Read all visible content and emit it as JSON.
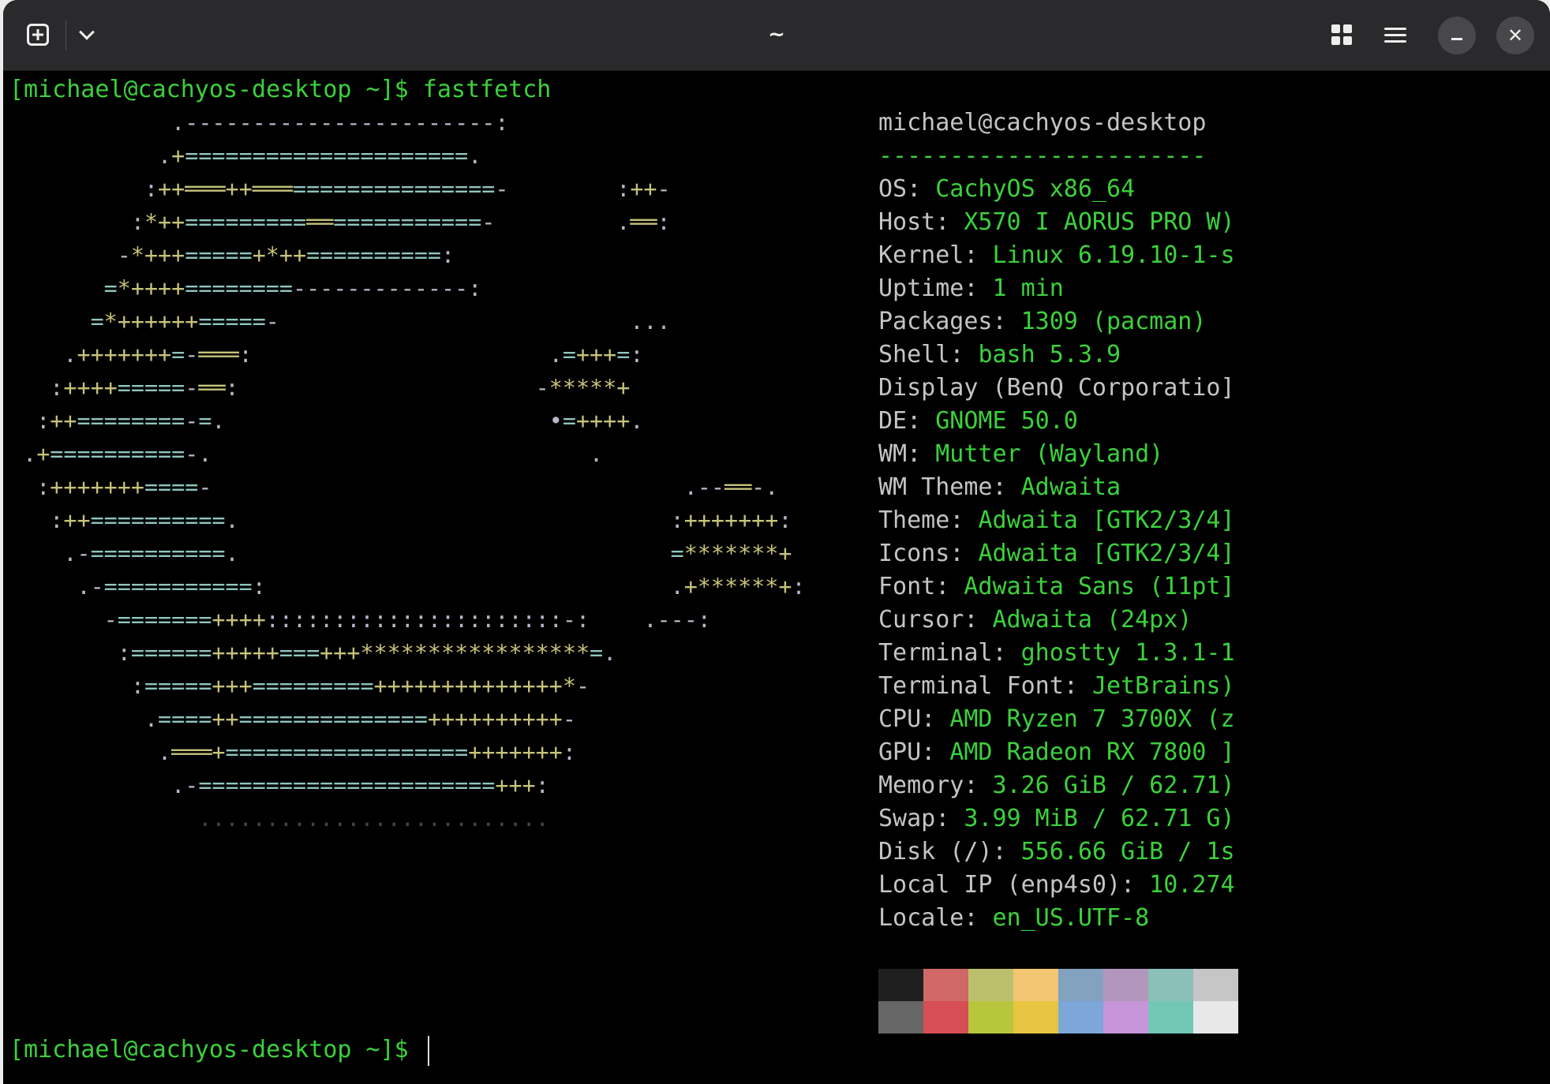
{
  "titlebar": {
    "title": "~"
  },
  "terminal": {
    "prompt1": "[michael@cachyos-desktop ~]$ ",
    "command1": "fastfetch",
    "prompt2": "[michael@cachyos-desktop ~]$ "
  },
  "logo_rows": [
    "            .-----------------------:",
    "           .+=====================.",
    "          :++═══++═══===============-        :++-",
    "         :*++=========══===========-         .══:",
    "        -*+++=====+*++==========:",
    "       =*++++========-------------:",
    "      =*++++++=====-                          ...",
    "    .+++++++=-═══:                      .=+++=:",
    "   :++++=====-══:                      -*****+",
    "  :++========-=.                        •=++++.",
    " .+==========-.                            .",
    "  :+++++++====-                                   .--══-.",
    "   :++==========.                                :+++++++:",
    "    .-==========.                                =*******+",
    "     .-===========:                              .+******+:",
    "       -=======++++::::::::::::::::::::::-:    .---:",
    "        :======+++++===+++*****************=.",
    "         :=====+++=========++++++++++++++*-",
    "          .====++==============++++++++++-",
    "           .═══+==================+++++++:",
    "            .-======================+++:",
    "              .........................."
  ],
  "info": {
    "header": "michael@cachyos-desktop",
    "separator": "-----------------------",
    "items": [
      {
        "key": "OS",
        "value": "CachyOS x86_64"
      },
      {
        "key": "Host",
        "value": "X570 I AORUS PRO W)"
      },
      {
        "key": "Kernel",
        "value": "Linux 6.19.10-1-s"
      },
      {
        "key": "Uptime",
        "value": "1 min"
      },
      {
        "key": "Packages",
        "value": "1309 (pacman)"
      },
      {
        "key": "Shell",
        "value": "bash 5.3.9"
      },
      {
        "key": "Display (BenQ Corporatio]",
        "value": "",
        "nocolon": true
      },
      {
        "key": "DE",
        "value": "GNOME 50.0"
      },
      {
        "key": "WM",
        "value": "Mutter (Wayland)"
      },
      {
        "key": "WM Theme",
        "value": "Adwaita"
      },
      {
        "key": "Theme",
        "value": "Adwaita [GTK2/3/4]"
      },
      {
        "key": "Icons",
        "value": "Adwaita [GTK2/3/4]"
      },
      {
        "key": "Font",
        "value": "Adwaita Sans (11pt]"
      },
      {
        "key": "Cursor",
        "value": "Adwaita (24px)"
      },
      {
        "key": "Terminal",
        "value": "ghostty 1.3.1-1"
      },
      {
        "key": "Terminal Font",
        "value": "JetBrains)"
      },
      {
        "key": "CPU",
        "value": "AMD Ryzen 7 3700X (z"
      },
      {
        "key": "GPU",
        "value": "AMD Radeon RX 7800 ]"
      },
      {
        "key": "Memory",
        "value": "3.26 GiB / 62.71)"
      },
      {
        "key": "Swap",
        "value": "3.99 MiB / 62.71 G)"
      },
      {
        "key": "Disk (/)",
        "value": "556.66 GiB / 1s"
      },
      {
        "key": "Local IP (enp4s0)",
        "value": "10.274"
      },
      {
        "key": "Locale",
        "value": "en_US.UTF-8"
      }
    ]
  },
  "palette": {
    "top": [
      "#1f1f1f",
      "#d06868",
      "#bcc06e",
      "#f2c672",
      "#82a2bf",
      "#b296bb",
      "#8ac0b8",
      "#c6c6c6"
    ],
    "bottom": [
      "#666666",
      "#d64f55",
      "#b7c63c",
      "#e6c540",
      "#7da6d9",
      "#c695da",
      "#72c6b4",
      "#e8e8e8"
    ]
  }
}
